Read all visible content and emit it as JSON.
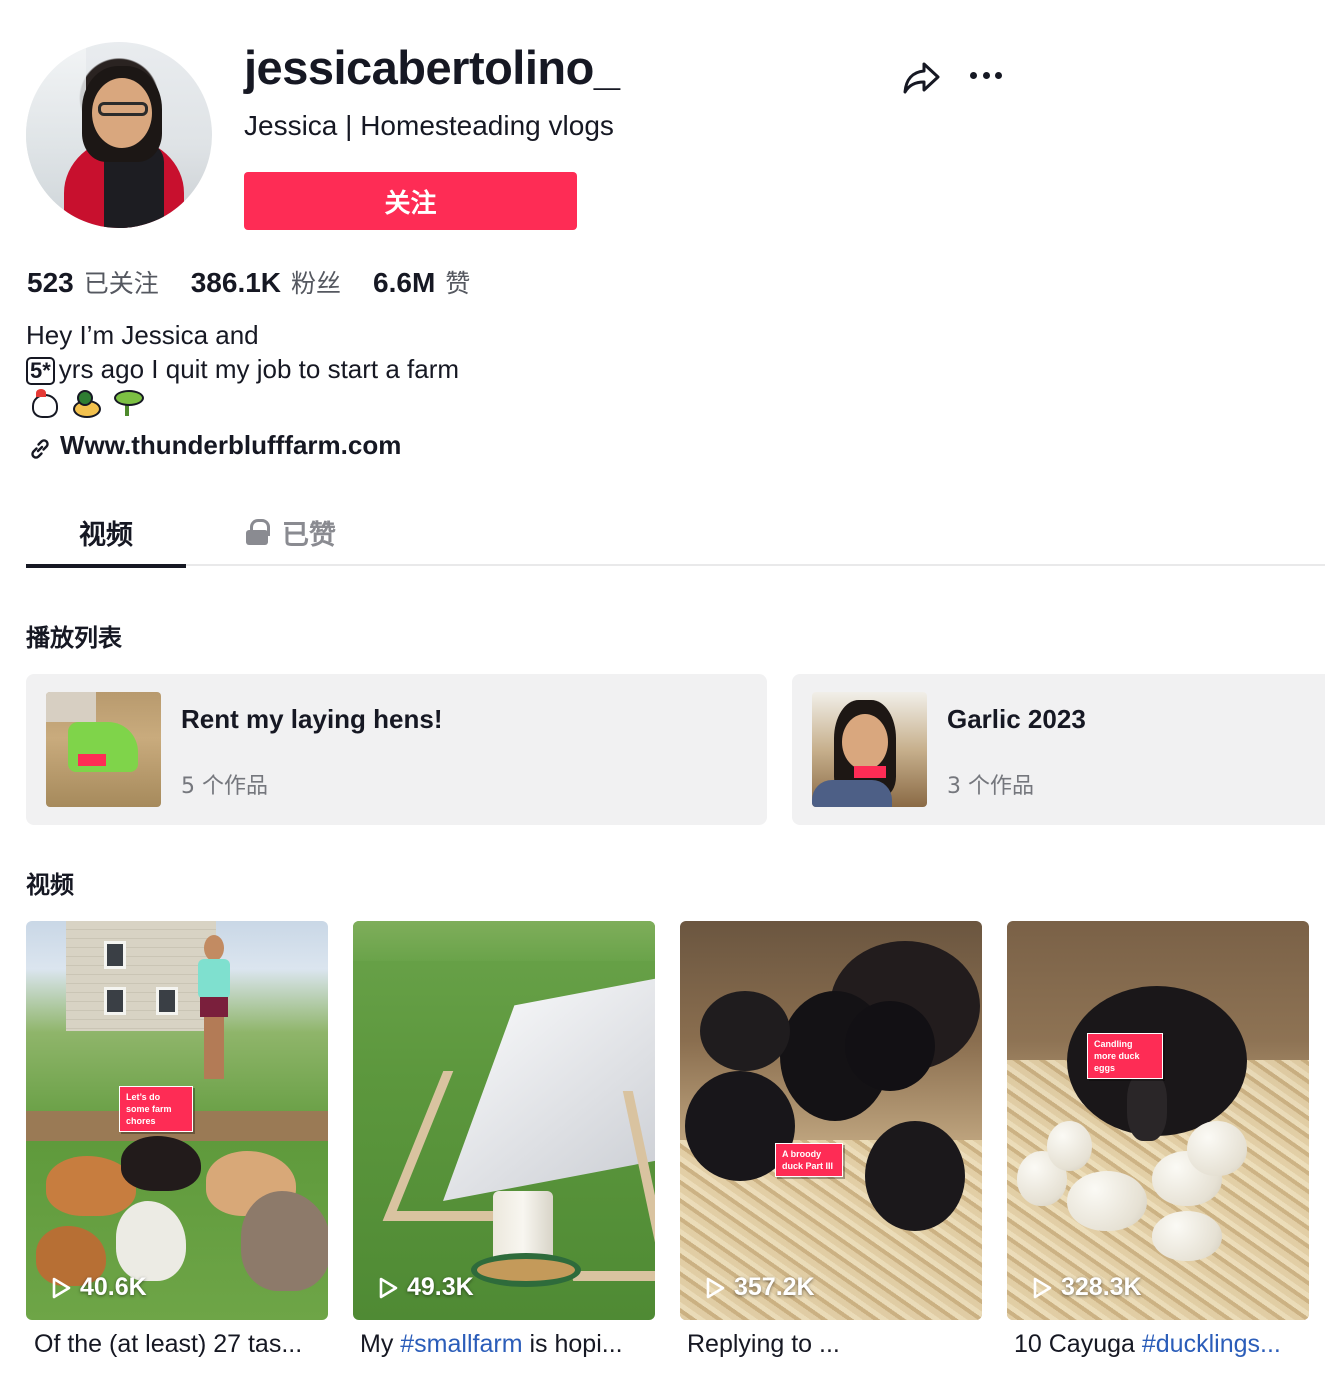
{
  "profile": {
    "username": "jessicabertolino_",
    "nickname": "Jessica | Homesteading vlogs",
    "follow_label": "关注"
  },
  "stats": [
    {
      "value": "523",
      "label": "已关注"
    },
    {
      "value": "386.1K",
      "label": "粉丝"
    },
    {
      "value": "6.6M",
      "label": "赞"
    }
  ],
  "bio": {
    "line1": "Hey I’m Jessica and",
    "keycap": "5*",
    "line2": "yrs ago I quit my job to start a farm",
    "emojis": [
      "chicken-icon",
      "duck-icon",
      "sprout-icon"
    ],
    "link": "Www.thunderblufffarm.com"
  },
  "tabs": [
    {
      "label": "视频",
      "active": true
    },
    {
      "label": "已赞",
      "locked": true
    }
  ],
  "playlists_title": "播放列表",
  "playlists": [
    {
      "title": "Rent my laying hens!",
      "count": "5 个作品"
    },
    {
      "title": "Garlic 2023",
      "count": "3 个作品"
    }
  ],
  "videos_title": "视频",
  "videos": [
    {
      "views": "40.6K",
      "overlay": "Let’s do some farm chores",
      "caption": "Of the (at least) 27 tas..."
    },
    {
      "views": "49.3K",
      "caption_pre": "My ",
      "caption_tag": "#smallfarm",
      "caption_post": " is hopi..."
    },
    {
      "views": "357.2K",
      "overlay": "A broody duck Part III",
      "caption": "Replying to ..."
    },
    {
      "views": "328.3K",
      "overlay": "Candling more duck eggs",
      "caption_pre": "10 Cayuga ",
      "caption_tag": "#ducklings..."
    }
  ],
  "colors": {
    "accent": "#fe2c55",
    "text": "#161823",
    "muted": "#75777d",
    "hashtag": "#2b5db9",
    "card_bg": "#f1f1f2"
  }
}
